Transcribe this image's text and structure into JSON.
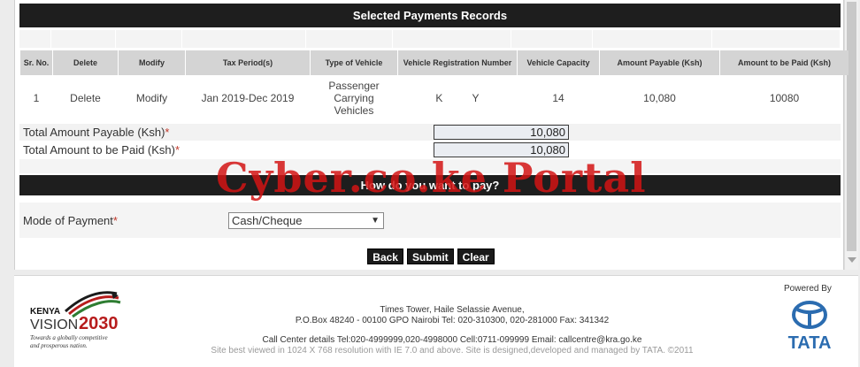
{
  "records": {
    "title": "Selected Payments Records",
    "columns": [
      "Sr. No.",
      "Delete",
      "Modify",
      "Tax Period(s)",
      "Type of Vehicle",
      "Vehicle Registration Number",
      "Vehicle Capacity",
      "Amount Payable (Ksh)",
      "Amount to be Paid (Ksh)"
    ],
    "rows": [
      {
        "sr_no": "1",
        "delete": "Delete",
        "modify": "Modify",
        "tax_period": "Jan 2019-Dec 2019",
        "vehicle_type": "Passenger Carrying Vehicles",
        "registration": "K          Y",
        "capacity": "14",
        "amount_payable": "10,080",
        "amount_to_pay": "10080"
      }
    ]
  },
  "totals": {
    "payable_label": "Total Amount Payable (Ksh)",
    "payable_value": "10,080",
    "paid_label": "Total Amount to be Paid (Ksh)",
    "paid_value": "10,080",
    "required_marker": "*"
  },
  "payment": {
    "title": "How do you want to pay?",
    "mode_label": "Mode of Payment",
    "mode_value": "Cash/Cheque"
  },
  "buttons": {
    "back": "Back",
    "submit": "Submit",
    "clear": "Clear"
  },
  "watermark": "Cyber.co.ke Portal",
  "footer": {
    "logo_country": "KENYA",
    "logo_vision": "VISION",
    "logo_year": "2030",
    "logo_tagline_1": "Towards a globally competitive",
    "logo_tagline_2": "and prosperous nation.",
    "address_1": "Times Tower, Haile Selassie Avenue,",
    "address_2": "P.O.Box 48240 - 00100 GPO Nairobi Tel: 020-310300, 020-281000 Fax: 341342",
    "call_center": "Call Center details Tel:020-4999999,020-4998000 Cell:0711-099999 Email: callcentre@kra.go.ke",
    "site_note": "Site best viewed in 1024 X 768 resolution with IE 7.0 and above. Site is designed,developed and managed by TATA. ©2011",
    "powered_by": "Powered By",
    "tata_text": "TATA"
  },
  "colors": {
    "bar": "#1e1e1e",
    "header_cell": "#d4d4d4",
    "required": "#c0392b",
    "watermark": "#d21414",
    "tata_blue": "#2b6cb0"
  }
}
